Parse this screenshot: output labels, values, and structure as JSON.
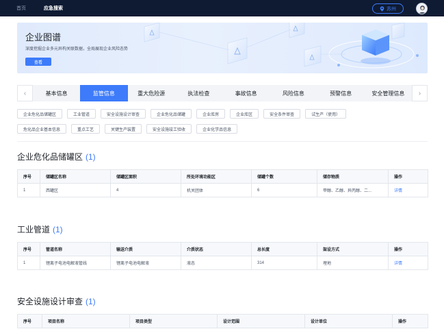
{
  "topbar": {
    "nav": [
      {
        "label": "首页",
        "active": false
      },
      {
        "label": "应急搜索",
        "active": true
      }
    ],
    "location": "苏州"
  },
  "banner": {
    "title": "企业图谱",
    "subtitle": "深度挖掘企业多元异构关联数据，全局展现企业风险态势",
    "button": "查看"
  },
  "tabs": {
    "items": [
      "基本信息",
      "监管信息",
      "重大危险源",
      "执法检查",
      "事故信息",
      "风险信息",
      "预警信息",
      "安全管理信息"
    ],
    "active_index": 1
  },
  "chips": {
    "row1": [
      "企业危化品储罐区",
      "工业管道",
      "安全设施设计审查",
      "企业危化品储罐",
      "企业库房",
      "企业库区",
      "安全条件审查",
      "试生产（使用）"
    ],
    "row2": [
      "危化品企业基本信息",
      "重点工艺",
      "关键生产装置",
      "安全设施竣工验收",
      "企业化学品信息"
    ]
  },
  "sections": {
    "storage": {
      "title": "企业危化品储罐区",
      "count": "(1)",
      "headers": [
        "序号",
        "储罐区名称",
        "储罐区面积",
        "所处环境功能区",
        "储罐个数",
        "储存物质",
        "操作"
      ],
      "rows": [
        [
          "1",
          "西罐区",
          "4",
          "机关团体",
          "6",
          "甲醇、乙醇、异丙醇、二...",
          "详情"
        ]
      ]
    },
    "pipeline": {
      "title": "工业管道",
      "count": "(1)",
      "headers": [
        "序号",
        "管道名称",
        "输送介质",
        "介质状态",
        "总长度",
        "架设方式",
        "操作"
      ],
      "rows": [
        [
          "1",
          "锂离子电池电解液管线",
          "锂离子电池电解液",
          "液态",
          "314",
          "埋地",
          "详情"
        ]
      ]
    },
    "design": {
      "title": "安全设施设计审查",
      "count": "(1)",
      "headers": [
        "序号",
        "项目名称",
        "项目类型",
        "设计范围",
        "设计单位",
        "操作"
      ]
    }
  }
}
